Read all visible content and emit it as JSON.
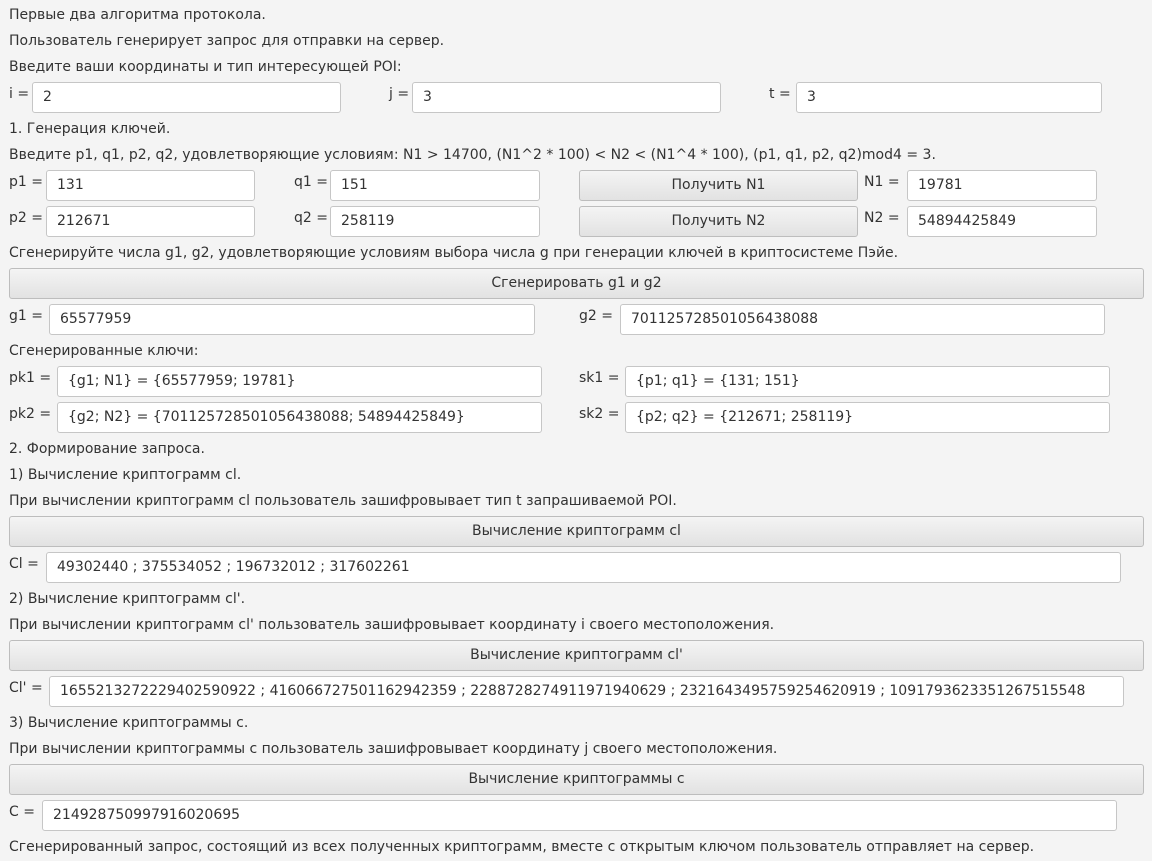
{
  "intro": {
    "line1": "Первые два алгоритма протокола.",
    "line2": "Пользователь генерирует запрос для отправки на сервер.",
    "line3": "Введите ваши координаты и тип интересующей POI:"
  },
  "coords": {
    "i_label": "i =",
    "i_value": "2",
    "j_label": "j =",
    "j_value": "3",
    "t_label": "t =",
    "t_value": "3"
  },
  "keygen": {
    "heading": "1. Генерация ключей.",
    "instruction": "Введите p1, q1, p2, q2, удовлетворяющие условиям: N1 > 14700, (N1^2 * 100) < N2 < (N1^4 * 100), (p1, q1, p2, q2)mod4 = 3.",
    "p1_label": "p1 =",
    "p1_value": "131",
    "q1_label": "q1 =",
    "q1_value": "151",
    "btn_n1": "Получить N1",
    "n1_label": "N1 =",
    "n1_value": "19781",
    "p2_label": "p2 =",
    "p2_value": "212671",
    "q2_label": "q2 =",
    "q2_value": "258119",
    "btn_n2": "Получить N2",
    "n2_label": "N2 =",
    "n2_value": "54894425849",
    "g_instruction": "Сгенерируйте числа g1, g2, удовлетворяющие условиям выбора числа g при генерации ключей в криптосистеме Пэйе.",
    "btn_g": "Сгенерировать g1 и g2",
    "g1_label": "g1 =",
    "g1_value": "65577959",
    "g2_label": "g2 =",
    "g2_value": "701125728501056438088",
    "keys_heading": "Сгенерированные ключи:",
    "pk1_label": "pk1 =",
    "pk1_value": "{g1; N1} = {65577959; 19781}",
    "sk1_label": "sk1 =",
    "sk1_value": "{p1; q1} = {131; 151}",
    "pk2_label": "pk2 =",
    "pk2_value": "{g2; N2} = {701125728501056438088; 54894425849}",
    "sk2_label": "sk2 =",
    "sk2_value": "{p2; q2} = {212671; 258119}"
  },
  "request": {
    "heading": "2. Формирование запроса.",
    "cl_heading": "1) Вычисление криптограмм cl.",
    "cl_desc": "При вычислении криптограмм cl пользователь зашифровывает тип t запрашиваемой POI.",
    "btn_cl": "Вычисление криптограмм cl",
    "cl_label": "Cl =",
    "cl_value": "49302440 ; 375534052 ; 196732012 ; 317602261",
    "clp_heading": "2) Вычисление криптограмм cl'.",
    "clp_desc": "При вычислении криптограмм cl' пользователь зашифровывает координату i своего местоположения.",
    "btn_clp": "Вычисление криптограмм cl'",
    "clp_label": "Cl' =",
    "clp_value": "1655213272229402590922 ; 4160667275011629423​59 ; 2288728274911971940629 ; 2321643495759254620919 ; 1091793623351267515548",
    "c_heading": "3) Вычисление криптограммы c.",
    "c_desc": "При вычислении криптограммы c пользователь зашифровывает координату j своего местоположения.",
    "btn_c": "Вычисление криптограммы c",
    "c_label": "C =",
    "c_value": "2149287509979160206​95",
    "footer": "Сгенерированный запрос, состоящий из всех полученных криптограмм, вместе с открытым ключом пользователь отправляет на сервер."
  }
}
